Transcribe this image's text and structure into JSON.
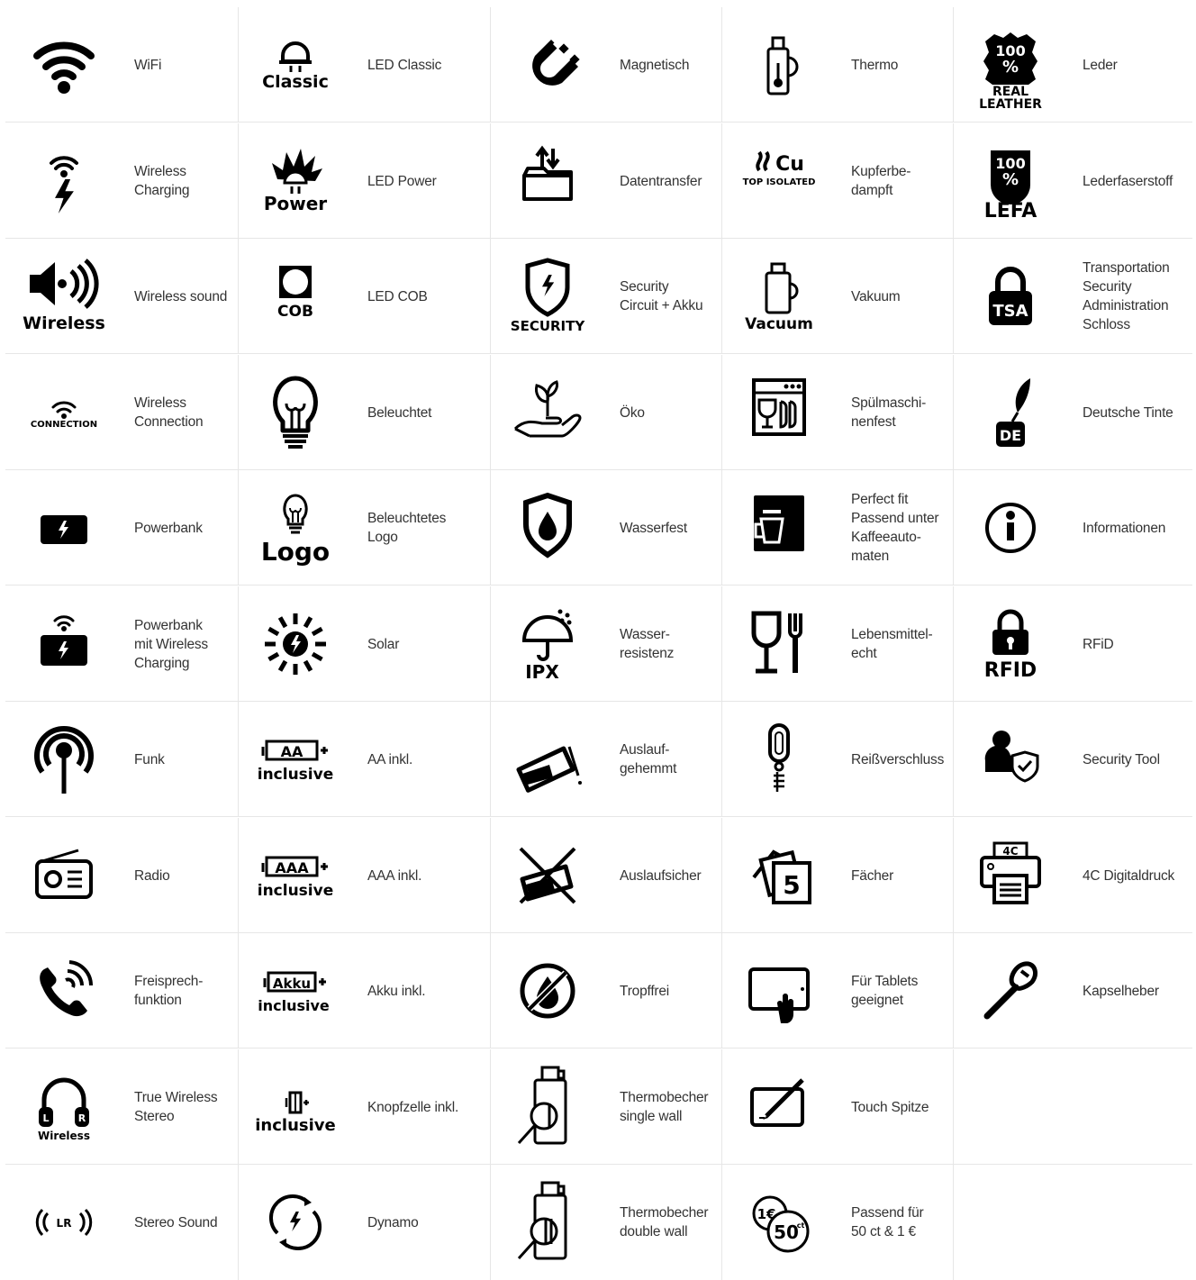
{
  "icon_color": "#000000",
  "divider_color": "#e6e6e6",
  "rows": [
    [
      {
        "icon": "wifi-icon",
        "label": "WiFi",
        "icon_text": ""
      },
      {
        "icon": "led-classic-icon",
        "label": "LED Classic",
        "icon_text": "Classic"
      },
      {
        "icon": "magnet-icon",
        "label": "Magnetisch",
        "icon_text": ""
      },
      {
        "icon": "thermo-icon",
        "label": "Thermo",
        "icon_text": ""
      },
      {
        "icon": "real-leather-icon",
        "label": "Leder",
        "icon_text": "100 % REAL LEATHER"
      }
    ],
    [
      {
        "icon": "wireless-charging-icon",
        "label": "Wireless\nCharging",
        "icon_text": ""
      },
      {
        "icon": "led-power-icon",
        "label": "LED Power",
        "icon_text": "Power"
      },
      {
        "icon": "data-transfer-icon",
        "label": "Datentransfer",
        "icon_text": ""
      },
      {
        "icon": "copper-icon",
        "label": "Kupferbe-\ndampft",
        "icon_text": "Cu TOP ISOLATED"
      },
      {
        "icon": "lefa-icon",
        "label": "Lederfaserstoff",
        "icon_text": "100 % LEFA"
      }
    ],
    [
      {
        "icon": "wireless-sound-icon",
        "label": "Wireless sound",
        "icon_text": "Wireless"
      },
      {
        "icon": "led-cob-icon",
        "label": "LED COB",
        "icon_text": "COB"
      },
      {
        "icon": "security-circuit-icon",
        "label": "Security\nCircuit + Akku",
        "icon_text": "SECURITY"
      },
      {
        "icon": "vacuum-icon",
        "label": "Vakuum",
        "icon_text": "Vacuum"
      },
      {
        "icon": "tsa-lock-icon",
        "label": "Transportation\nSecurity\nAdministration\nSchloss",
        "icon_text": "TSA"
      }
    ],
    [
      {
        "icon": "wireless-connection-icon",
        "label": "Wireless\nConnection",
        "icon_text": "CONNECTION"
      },
      {
        "icon": "lightbulb-icon",
        "label": "Beleuchtet",
        "icon_text": ""
      },
      {
        "icon": "eco-plant-icon",
        "label": "Öko",
        "icon_text": ""
      },
      {
        "icon": "dishwasher-icon",
        "label": "Spülmaschi-\nnenfest",
        "icon_text": ""
      },
      {
        "icon": "ink-pen-icon",
        "label": "Deutsche Tinte",
        "icon_text": "DE"
      }
    ],
    [
      {
        "icon": "powerbank-icon",
        "label": "Powerbank",
        "icon_text": ""
      },
      {
        "icon": "illuminated-logo-icon",
        "label": "Beleuchtetes\nLogo",
        "icon_text": "Logo"
      },
      {
        "icon": "waterproof-icon",
        "label": "Wasserfest",
        "icon_text": ""
      },
      {
        "icon": "coffee-machine-icon",
        "label": "Perfect fit\nPassend unter\nKaffeeauto-\nmaten",
        "icon_text": ""
      },
      {
        "icon": "info-icon",
        "label": "Informationen",
        "icon_text": ""
      }
    ],
    [
      {
        "icon": "powerbank-wireless-icon",
        "label": "Powerbank\nmit Wireless\nCharging",
        "icon_text": ""
      },
      {
        "icon": "solar-icon",
        "label": "Solar",
        "icon_text": ""
      },
      {
        "icon": "ipx-umbrella-icon",
        "label": "Wasser-\nresistenz",
        "icon_text": "IPX"
      },
      {
        "icon": "food-safe-icon",
        "label": "Lebensmittel-\necht",
        "icon_text": ""
      },
      {
        "icon": "rfid-lock-icon",
        "label": "RFiD",
        "icon_text": "RFID"
      }
    ],
    [
      {
        "icon": "radio-antenna-icon",
        "label": "Funk",
        "icon_text": ""
      },
      {
        "icon": "battery-aa-icon",
        "label": "AA inkl.",
        "icon_text": "AA inclusive"
      },
      {
        "icon": "spill-stop-icon",
        "label": "Auslauf-\ngehemmt",
        "icon_text": ""
      },
      {
        "icon": "zipper-icon",
        "label": "Reißverschluss",
        "icon_text": ""
      },
      {
        "icon": "security-tool-icon",
        "label": "Security Tool",
        "icon_text": ""
      }
    ],
    [
      {
        "icon": "radio-icon",
        "label": "Radio",
        "icon_text": ""
      },
      {
        "icon": "battery-aaa-icon",
        "label": "AAA inkl.",
        "icon_text": "AAA inclusive"
      },
      {
        "icon": "leakproof-icon",
        "label": "Auslaufsicher",
        "icon_text": ""
      },
      {
        "icon": "compartments-icon",
        "label": "Fächer",
        "icon_text": "5"
      },
      {
        "icon": "printer-icon",
        "label": "4C Digitaldruck",
        "icon_text": "4C"
      }
    ],
    [
      {
        "icon": "handsfree-phone-icon",
        "label": "Freisprech-\nfunktion",
        "icon_text": ""
      },
      {
        "icon": "battery-akku-icon",
        "label": "Akku inkl.",
        "icon_text": "Akku inclusive"
      },
      {
        "icon": "drip-free-icon",
        "label": "Tropffrei",
        "icon_text": ""
      },
      {
        "icon": "tablet-icon",
        "label": "Für Tablets\ngeeignet",
        "icon_text": ""
      },
      {
        "icon": "bottle-opener-icon",
        "label": "Kapselheber",
        "icon_text": ""
      }
    ],
    [
      {
        "icon": "headphones-icon",
        "label": "True Wireless\nStereo",
        "icon_text": "L R Wireless"
      },
      {
        "icon": "button-cell-icon",
        "label": "Knopfzelle inkl.",
        "icon_text": "inclusive"
      },
      {
        "icon": "thermo-single-wall-icon",
        "label": "Thermobecher\nsingle wall",
        "icon_text": ""
      },
      {
        "icon": "touch-pen-icon",
        "label": "Touch Spitze",
        "icon_text": ""
      },
      null
    ],
    [
      {
        "icon": "stereo-sound-icon",
        "label": "Stereo Sound",
        "icon_text": "LR"
      },
      {
        "icon": "dynamo-icon",
        "label": "Dynamo",
        "icon_text": ""
      },
      {
        "icon": "thermo-double-wall-icon",
        "label": "Thermobecher\ndouble wall",
        "icon_text": ""
      },
      {
        "icon": "coin-icon",
        "label": "Passend für\n50 ct & 1 €",
        "icon_text": "1€ 50ct"
      },
      null
    ]
  ]
}
